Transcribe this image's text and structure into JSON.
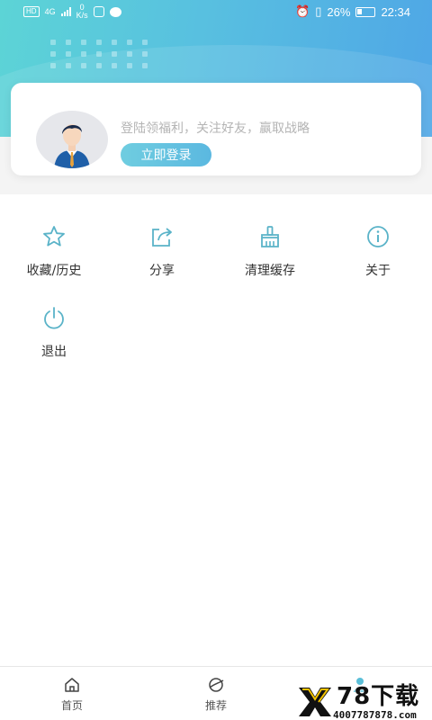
{
  "status_bar": {
    "hd_badge": "HD",
    "network_type": "4G",
    "speed_value": "0",
    "speed_unit": "K/s",
    "battery_percent": "26%",
    "time": "22:34"
  },
  "profile": {
    "slogan": "登陆领福利，关注好友，赢取战略",
    "login_button": "立即登录"
  },
  "menu": {
    "items": [
      {
        "label": "收藏/历史",
        "icon": "star-icon"
      },
      {
        "label": "分享",
        "icon": "share-icon"
      },
      {
        "label": "清理缓存",
        "icon": "broom-icon"
      },
      {
        "label": "关于",
        "icon": "info-icon"
      },
      {
        "label": "退出",
        "icon": "power-icon"
      }
    ]
  },
  "tabbar": {
    "tabs": [
      {
        "label": "首页",
        "icon": "home-icon"
      },
      {
        "label": "推荐",
        "icon": "planet-icon"
      },
      {
        "label": "",
        "icon": "user-icon"
      }
    ]
  },
  "watermark": {
    "brand": "78下载",
    "phone": "4007787878.com"
  },
  "colors": {
    "accent": "#5bbfd8",
    "header_gradient_start": "#5cd4d6",
    "header_gradient_end": "#4fa6e6",
    "icon_color": "#5ab3c8"
  }
}
